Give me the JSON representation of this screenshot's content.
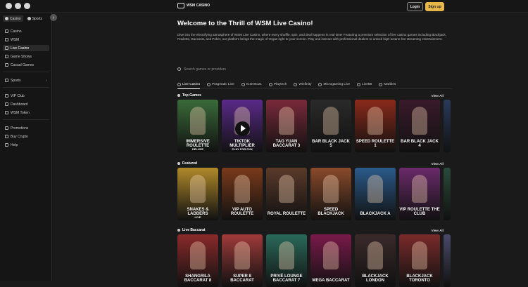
{
  "header": {
    "logo_text": "WSM CASINO",
    "login_label": "Login",
    "signup_label": "Sign up",
    "social_icons": [
      "x-icon",
      "instagram-icon",
      "telegram-icon"
    ]
  },
  "sidebar": {
    "tabs": [
      {
        "label": "Casino"
      },
      {
        "label": "Sports"
      }
    ],
    "collapse_icon": "‹",
    "items": [
      {
        "label": "Casino"
      },
      {
        "label": "WSM"
      },
      {
        "label": "Live Casino"
      },
      {
        "label": "Game Shows"
      },
      {
        "label": "Casual Games"
      },
      {
        "label": "Sports"
      },
      {
        "label": "VIP Club"
      },
      {
        "label": "Dashboard"
      },
      {
        "label": "WSM Token"
      },
      {
        "label": "Promotions"
      },
      {
        "label": "Buy Crypto"
      },
      {
        "label": "Help"
      }
    ]
  },
  "main": {
    "title": "Welcome to the Thrill of WSM Live Casino!",
    "intro": "Dive into the electrifying atmosphere of WSM Live Casino, where every shuffle, spin, and deal happens in real time! Featuring a premium selection of live casino games including Blackjack, Roulette, Baccarat, and Poker, our platform brings the magic of Vegas right to your screen. Play and interact with professional dealers to unlock high-octane live streaming entertainment.",
    "search_placeholder": "Search games or providers",
    "providers": [
      {
        "label": "Live Casino"
      },
      {
        "label": "Pragmatic Live"
      },
      {
        "label": "ICONIC21"
      },
      {
        "label": "Playtech"
      },
      {
        "label": "Winfinity"
      },
      {
        "label": "Microgaming Live"
      },
      {
        "label": "Live88"
      },
      {
        "label": "Marbles"
      }
    ],
    "view_all": "View All",
    "sections": [
      {
        "title": "Top Games",
        "cards": [
          {
            "title": "IMMERSIVE ROULETTE",
            "sub": "DELUXE",
            "color": "#3a6b3a"
          },
          {
            "title": "TIKTOK MULTIPLIER",
            "sub": "PLAY FOR FUN",
            "color": "#5a2a8a"
          },
          {
            "title": "TAO YUAN BACCARAT 3",
            "sub": "",
            "color": "#7a2a3a"
          },
          {
            "title": "BAR BLACK JACK 5",
            "sub": "",
            "color": "#2a2a2a"
          },
          {
            "title": "SPEED ROULETTE 1",
            "sub": "",
            "color": "#8a2a1a"
          },
          {
            "title": "BAR BLACK JACK 4",
            "sub": "",
            "color": "#3a1a2a"
          },
          {
            "title": "",
            "sub": "",
            "color": "#2a3a5a"
          }
        ]
      },
      {
        "title": "Featured",
        "cards": [
          {
            "title": "SNAKES & LADDERS",
            "sub": "LIVE",
            "color": "#b08a2a"
          },
          {
            "title": "VIP AUTO ROULETTE",
            "sub": "",
            "color": "#7a3a1a"
          },
          {
            "title": "ROYAL ROULETTE",
            "sub": "",
            "color": "#5a3a2a"
          },
          {
            "title": "SPEED BLACKJACK",
            "sub": "",
            "color": "#8a4a2a"
          },
          {
            "title": "BLACKJACK A",
            "sub": "",
            "color": "#2a5a8a"
          },
          {
            "title": "VIP ROULETTE THE CLUB",
            "sub": "",
            "color": "#6a2a6a"
          },
          {
            "title": "",
            "sub": "",
            "color": "#2a4a3a"
          }
        ]
      },
      {
        "title": "Live Baccarat",
        "cards": [
          {
            "title": "SHANGRILA BACCARAT 8",
            "sub": "",
            "color": "#8a2a2a"
          },
          {
            "title": "SUPER 8 BACCARAT",
            "sub": "",
            "color": "#a03a3a"
          },
          {
            "title": "PRIVÉ LOUNGE BACCARAT 7",
            "sub": "",
            "color": "#2a6a5a"
          },
          {
            "title": "MEGA BACCARAT",
            "sub": "",
            "color": "#7a1a4a"
          },
          {
            "title": "BLACKJACK LONDON",
            "sub": "",
            "color": "#3a2a2a"
          },
          {
            "title": "BLACKJACK TORONTO",
            "sub": "",
            "color": "#7a2a2a"
          },
          {
            "title": "",
            "sub": "",
            "color": "#4a4a6a"
          }
        ]
      }
    ]
  }
}
